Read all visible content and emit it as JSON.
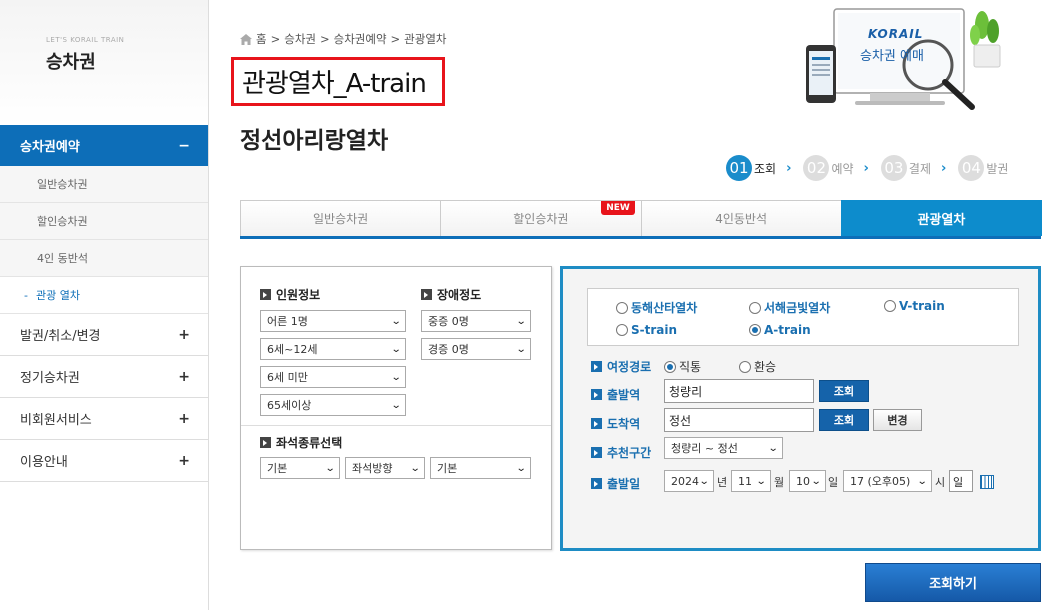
{
  "sidebar": {
    "tagline": "LET'S KORAIL TRAIN",
    "title": "승차권",
    "menu": [
      {
        "label": "승차권예약",
        "toggle": "−"
      },
      {
        "label": "발권/취소/변경",
        "toggle": "+"
      },
      {
        "label": "정기승차권",
        "toggle": "+"
      },
      {
        "label": "비회원서비스",
        "toggle": "+"
      },
      {
        "label": "이용안내",
        "toggle": "+"
      }
    ],
    "submenu": [
      "일반승차권",
      "할인승차권",
      "4인 동반석",
      "관광 열차"
    ],
    "current_dash": "-"
  },
  "breadcrumb": {
    "home": "홈",
    "sep": ">",
    "items": [
      "승차권",
      "승차권예약",
      "관광열차"
    ]
  },
  "page_title": "관광열차_A-train",
  "sub_title": "정선아리랑열차",
  "promo": {
    "brand": "KORAIL",
    "text": "승차권 예매"
  },
  "steps": [
    {
      "num": "01",
      "label": "조회"
    },
    {
      "num": "02",
      "label": "예약"
    },
    {
      "num": "03",
      "label": "결제"
    },
    {
      "num": "04",
      "label": "발권"
    }
  ],
  "tabs": [
    "일반승차권",
    "할인승차권",
    "4인동반석",
    "관광열차"
  ],
  "new_badge": "NEW",
  "passengers": {
    "heading": "인원정보",
    "adult": "어른 1명",
    "child": "6세~12세",
    "infant": "6세 미만",
    "senior": "65세이상"
  },
  "disability": {
    "heading": "장애정도",
    "severe": "중증 0명",
    "mild": "경증 0명"
  },
  "seat": {
    "heading": "좌석종류선택",
    "type": "기본",
    "direction": "좌석방향",
    "extra": "기본"
  },
  "trains": [
    "동해산타열차",
    "서해금빛열차",
    "V-train",
    "S-train",
    "A-train"
  ],
  "selected_train": "A-train",
  "form": {
    "route_label": "여정경로",
    "route_direct": "직통",
    "route_transfer": "환승",
    "dep_label": "출발역",
    "dep_value": "청량리",
    "arr_label": "도착역",
    "arr_value": "정선",
    "search_btn": "조회",
    "swap_btn": "변경",
    "recommend_label": "추천구간",
    "recommend_value": "청량리 ~ 정선",
    "date_label": "출발일",
    "year": "2024",
    "year_unit": "년",
    "month": "11",
    "month_unit": "월",
    "day": "10",
    "day_unit": "일",
    "hour": "17 (오후05)",
    "hour_unit": "시",
    "weekday": "일"
  },
  "submit_label": "조회하기",
  "colors": {
    "primary": "#0d6eb8",
    "accent": "#1e8cc4",
    "highlight": "#e8141b"
  }
}
